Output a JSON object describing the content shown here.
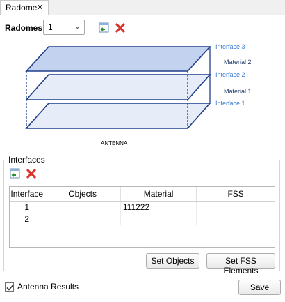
{
  "tab": {
    "label": "Radome",
    "close": "×"
  },
  "radomes": {
    "label": "Radomes:",
    "selected": "1"
  },
  "diagram": {
    "interfaces": [
      "Interface 3",
      "Interface 2",
      "Interface 1"
    ],
    "materials": [
      "Material 2",
      "Material 1"
    ],
    "antenna": "ANTENNA",
    "colors": {
      "label": "#3a7bd5",
      "material_label": "#1f3a6e",
      "edge": "#1f3f8a",
      "top_fill": "#c3d3ef",
      "layer_fill": "#e6edf8"
    }
  },
  "interfaces_group": {
    "title": "Interfaces",
    "columns": [
      "Interface",
      "Objects",
      "Material",
      "FSS"
    ],
    "rows": [
      {
        "interface": "1",
        "objects": "",
        "material": "111222",
        "fss": ""
      },
      {
        "interface": "2",
        "objects": "",
        "material": "",
        "fss": ""
      }
    ],
    "set_objects": "Set Objects",
    "set_fss": "Set FSS Elements"
  },
  "footer": {
    "antenna_results": "Antenna Results",
    "antenna_results_checked": true,
    "save": "Save"
  }
}
